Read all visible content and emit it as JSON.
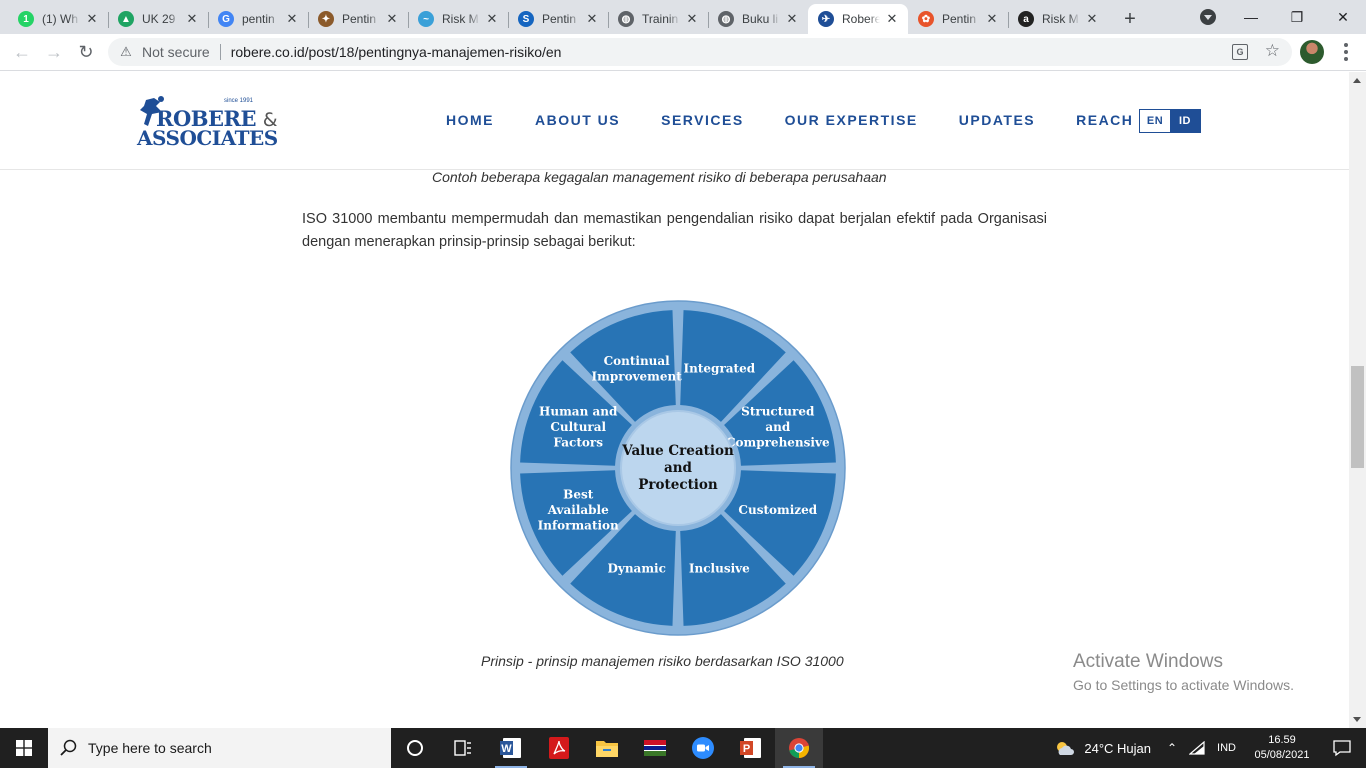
{
  "browser": {
    "tabs": [
      {
        "title": "(1) Wh",
        "favicon": "whatsapp-icon",
        "color": "#25d366",
        "glyph": "1"
      },
      {
        "title": "UK 29",
        "favicon": "google-drive-icon",
        "color": "#1fa463",
        "glyph": "▲"
      },
      {
        "title": "pentin",
        "favicon": "google-icon",
        "color": "#4285f4",
        "glyph": "G"
      },
      {
        "title": "Pentin",
        "favicon": "ministry-emblem-icon",
        "color": "#8b5a2b",
        "glyph": "✦"
      },
      {
        "title": "Risk M",
        "favicon": "wave-logo-icon",
        "color": "#3aa0d8",
        "glyph": "~"
      },
      {
        "title": "Pentin",
        "favicon": "s-logo-icon",
        "color": "#1565c0",
        "glyph": "S"
      },
      {
        "title": "Trainin",
        "favicon": "globe-icon",
        "color": "#5f6368",
        "glyph": "◍"
      },
      {
        "title": "Buku li",
        "favicon": "globe-icon",
        "color": "#5f6368",
        "glyph": "◍"
      },
      {
        "title": "Robere",
        "favicon": "robere-logo-icon",
        "color": "#1f4e96",
        "glyph": "✈",
        "active": true
      },
      {
        "title": "Pentin",
        "favicon": "flower-logo-icon",
        "color": "#e8542b",
        "glyph": "✿"
      },
      {
        "title": "Risk M",
        "favicon": "amazon-icon",
        "color": "#222222",
        "glyph": "a"
      }
    ],
    "address": {
      "security_label": "Not secure",
      "url": "robere.co.id/post/18/pentingnya-manajemen-risiko/en"
    }
  },
  "site": {
    "logo": {
      "line1": "ROBERE",
      "amp": "&",
      "line2": "ASSOCIATES",
      "since": "since 1991"
    },
    "nav": [
      "HOME",
      "ABOUT US",
      "SERVICES",
      "OUR EXPERTISE",
      "UPDATES",
      "REACH US"
    ],
    "lang": {
      "en": "EN",
      "id": "ID"
    },
    "brand_color": "#1f4e96"
  },
  "article": {
    "caption_top": "Contoh beberapa kegagalan management risiko di beberapa perusahaan",
    "paragraph": "ISO 31000 membantu mempermudah dan memastikan pengendalian risiko dapat berjalan efektif pada Organisasi dengan menerapkan prinsip-prinsip sebagai berikut:",
    "diagram": {
      "center": [
        "Value Creation",
        "and",
        "Protection"
      ],
      "segments": [
        {
          "lines": [
            "Integrated"
          ]
        },
        {
          "lines": [
            "Structured",
            "and",
            "Comprehensive"
          ]
        },
        {
          "lines": [
            "Customized"
          ]
        },
        {
          "lines": [
            "Inclusive"
          ]
        },
        {
          "lines": [
            "Dynamic"
          ]
        },
        {
          "lines": [
            "Best",
            "Available",
            "Information"
          ]
        },
        {
          "lines": [
            "Human and",
            "Cultural",
            "Factors"
          ]
        },
        {
          "lines": [
            "Continual",
            "Improvement"
          ]
        }
      ],
      "segment_color": "#2874b5",
      "center_color": "#bcd6ee",
      "rim_color": "#8ab4dc"
    },
    "caption_bottom": "Prinsip - prinsip manajemen risiko berdasarkan ISO 31000"
  },
  "watermark": {
    "title": "Activate Windows",
    "subtitle": "Go to Settings to activate Windows."
  },
  "taskbar": {
    "search_placeholder": "Type here to search",
    "apps": [
      "task-view-icon",
      "word-icon",
      "acrobat-icon",
      "file-explorer-icon",
      "gambia-flag-icon",
      "zoom-icon",
      "powerpoint-icon",
      "chrome-icon"
    ],
    "weather": "24°C  Hujan",
    "language": "IND",
    "time": "16.59",
    "date": "05/08/2021"
  }
}
